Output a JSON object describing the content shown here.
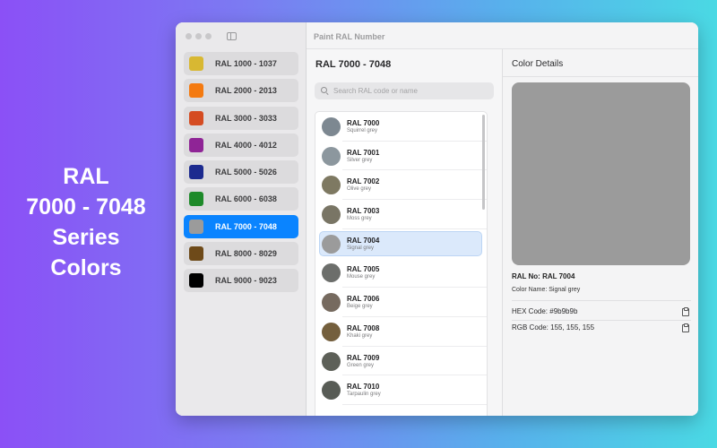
{
  "promo": {
    "lines": [
      "RAL",
      "7000 - 7048",
      "Series",
      "Colors"
    ]
  },
  "window": {
    "title": "Paint RAL Number"
  },
  "sidebar": {
    "items": [
      {
        "label": "RAL 1000 - 1037",
        "color": "#d8b832",
        "selected": false
      },
      {
        "label": "RAL 2000 - 2013",
        "color": "#f47a10",
        "selected": false
      },
      {
        "label": "RAL 3000 - 3033",
        "color": "#d54c22",
        "selected": false
      },
      {
        "label": "RAL 4000 - 4012",
        "color": "#8f2496",
        "selected": false
      },
      {
        "label": "RAL 5000 - 5026",
        "color": "#1c2a8f",
        "selected": false
      },
      {
        "label": "RAL 6000 - 6038",
        "color": "#1e8a2a",
        "selected": false
      },
      {
        "label": "RAL 7000 - 7048",
        "color": "#9b9b9b",
        "selected": true
      },
      {
        "label": "RAL 8000 - 8029",
        "color": "#6e4a19",
        "selected": false
      },
      {
        "label": "RAL 9000 - 9023",
        "color": "#000000",
        "selected": false
      }
    ]
  },
  "list": {
    "title": "RAL 7000 - 7048",
    "search_placeholder": "Search RAL code or name",
    "items": [
      {
        "code": "RAL 7000",
        "name": "Squirrel grey",
        "color": "#7d8891",
        "selected": false
      },
      {
        "code": "RAL 7001",
        "name": "Silver grey",
        "color": "#8c979e",
        "selected": false
      },
      {
        "code": "RAL 7002",
        "name": "Olive grey",
        "color": "#7e7962",
        "selected": false
      },
      {
        "code": "RAL 7003",
        "name": "Moss grey",
        "color": "#797565",
        "selected": false
      },
      {
        "code": "RAL 7004",
        "name": "Signal grey",
        "color": "#9b9b9b",
        "selected": true
      },
      {
        "code": "RAL 7005",
        "name": "Mouse grey",
        "color": "#6c6e6b",
        "selected": false
      },
      {
        "code": "RAL 7006",
        "name": "Beige grey",
        "color": "#766a5f",
        "selected": false
      },
      {
        "code": "RAL 7008",
        "name": "Khaki grey",
        "color": "#745f3d",
        "selected": false
      },
      {
        "code": "RAL 7009",
        "name": "Green grey",
        "color": "#5d6058",
        "selected": false
      },
      {
        "code": "RAL 7010",
        "name": "Tarpaulin grey",
        "color": "#585c56",
        "selected": false
      }
    ]
  },
  "detail": {
    "title": "Color Details",
    "preview_color": "#9b9b9b",
    "ral_no": "RAL No: RAL 7004",
    "color_name": "Color Name: Signal grey",
    "hex": "HEX Code: #9b9b9b",
    "rgb": "RGB Code: 155, 155, 155"
  }
}
